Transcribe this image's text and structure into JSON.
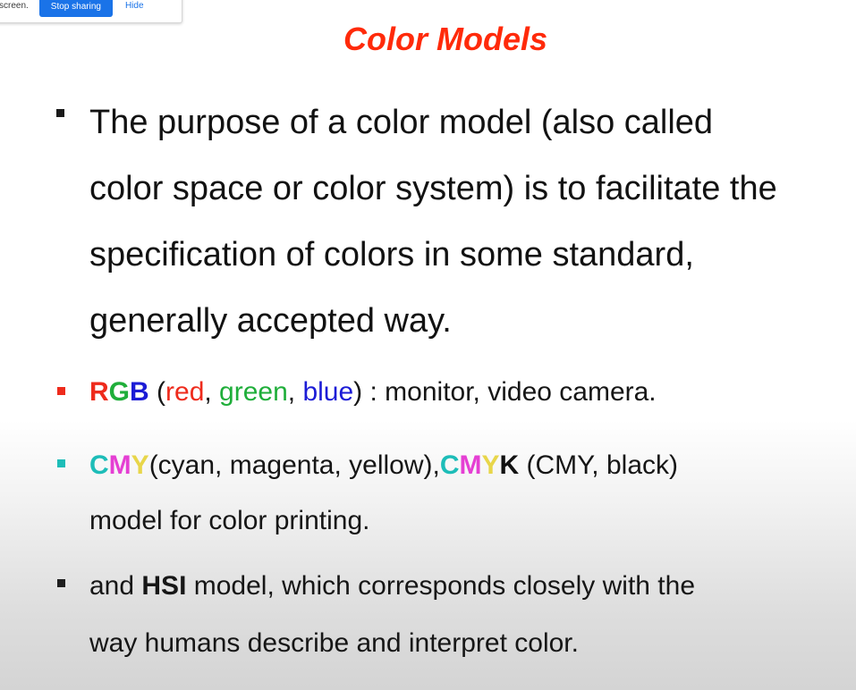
{
  "share_bar": {
    "message": "screen.",
    "stop_label": "Stop sharing",
    "hide_label": "Hide"
  },
  "slide": {
    "title": "Color Models",
    "main_bullet": [
      "The purpose of a color model (also called",
      "color space or color system) is to facilitate the",
      "specification of colors in some standard,",
      "generally accepted way."
    ],
    "rgb": {
      "r": "R",
      "g": "G",
      "b": "B",
      "open": " (",
      "red": "red",
      "sep1": ", ",
      "green": "green",
      "sep2": ", ",
      "blue": "blue",
      "rest": ") : monitor, video camera."
    },
    "cmy": {
      "c": "C",
      "m": "M",
      "y": "Y",
      "words": "(cyan, magenta, yellow),",
      "c2": "C",
      "m2": "M",
      "y2": "Y",
      "k": "K",
      "paren": " (CMY, black)",
      "line2": "model for color printing."
    },
    "hsi": {
      "pre": "and ",
      "hsi": "HSI",
      "post": " model, which corresponds closely with the",
      "line2": "way humans describe and interpret color."
    }
  },
  "colors": {
    "title": "#ff2a0a",
    "red": "#ee2b1c",
    "green": "#1fae3a",
    "blue": "#1c1cd6",
    "cyan": "#1dbdb8",
    "magenta": "#e53fd3",
    "yellow": "#e8d64a",
    "share_button": "#1a73e8"
  }
}
